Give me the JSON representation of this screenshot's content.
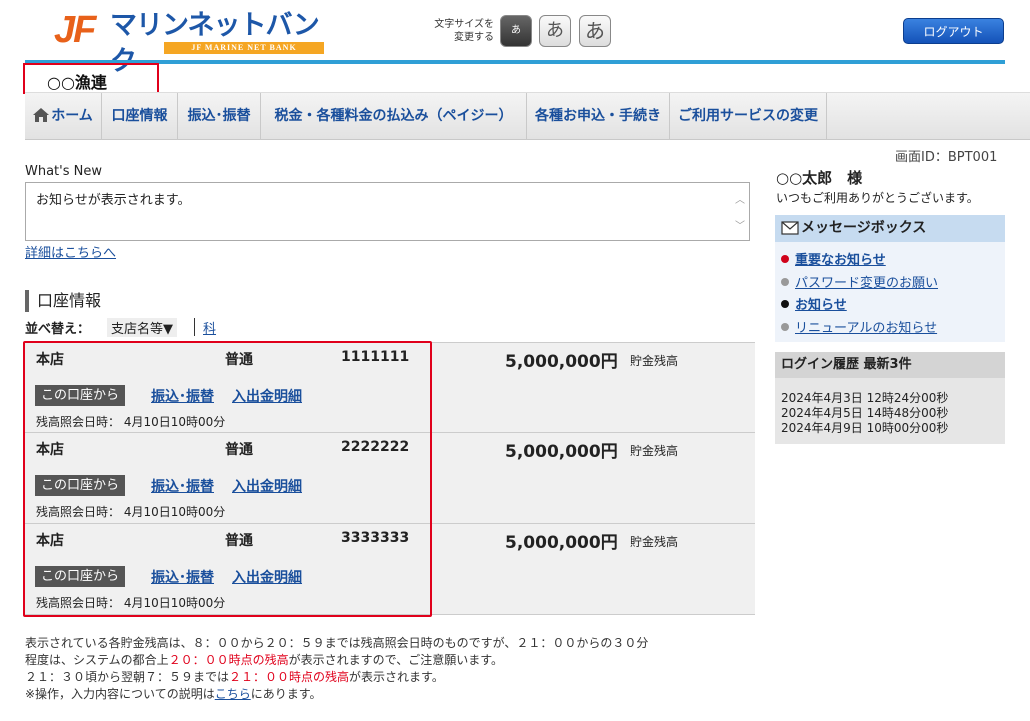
{
  "header": {
    "logo_jf": "JF",
    "logo_text": "マリンネットバンク",
    "logo_sub": "JF MARINE NET BANK",
    "font_size_label_1": "文字サイズを",
    "font_size_label_2": "変更する",
    "font_buttons": [
      "あ",
      "あ",
      "あ"
    ],
    "logout": "ログアウト",
    "org_name": "○○漁連"
  },
  "nav": {
    "items": [
      "ホーム",
      "口座情報",
      "振込･振替",
      "税金・各種料金の払込み（ペイジー）",
      "各種お申込・手続き",
      "ご利用サービスの変更"
    ]
  },
  "main": {
    "screen_id": "画面ID：BPT001",
    "whats_new_label": "What's New",
    "news_text": "お知らせが表示されます。",
    "detail_link": "詳細はこちらへ",
    "account_title": "口座情報",
    "sort_label": "並べ替え：",
    "sort_active": "支店名等▼",
    "sort_link": "科目",
    "accounts": [
      {
        "branch": "本店",
        "type": "普通",
        "number": "1111111",
        "balance": "5,000,000円",
        "balance_label": "貯金残高",
        "from_label": "この口座から",
        "transfer": "振込･振替",
        "detail": "入出金明細",
        "time": "残高照会日時： 4月10日10時00分"
      },
      {
        "branch": "本店",
        "type": "普通",
        "number": "2222222",
        "balance": "5,000,000円",
        "balance_label": "貯金残高",
        "from_label": "この口座から",
        "transfer": "振込･振替",
        "detail": "入出金明細",
        "time": "残高照会日時： 4月10日10時00分"
      },
      {
        "branch": "本店",
        "type": "普通",
        "number": "3333333",
        "balance": "5,000,000円",
        "balance_label": "貯金残高",
        "from_label": "この口座から",
        "transfer": "振込･振替",
        "detail": "入出金明細",
        "time": "残高照会日時： 4月10日10時00分"
      }
    ],
    "notes": {
      "line1": "表示されている各貯金残高は、８：００から２０：５９までは残高照会日時のものですが、２１：００からの３０分",
      "line2_a": "程度は、システムの都合上",
      "line2_red": "２０：００時点の残高",
      "line2_b": "が表示されますので、ご注意願います。",
      "line3_a": "２１：３０頃から翌朝７：５９までは",
      "line3_red": "２１：００時点の残高",
      "line3_b": "が表示されます。",
      "line4_a": "※操作，入力内容についての説明は",
      "line4_link": "こちら",
      "line4_b": "にあります。"
    }
  },
  "sidebar": {
    "user_name": "○○太郎　様",
    "greeting": "いつもご利用ありがとうございます。",
    "message_box_title": "メッセージボックス",
    "messages": [
      {
        "label": "重要なお知らせ",
        "color": "#d0021b"
      },
      {
        "label": "パスワード変更のお願い",
        "color": "#999999"
      },
      {
        "label": "お知らせ",
        "color": "#111111"
      },
      {
        "label": "リニューアルのお知らせ",
        "color": "#999999"
      }
    ],
    "login_history_title": "ログイン履歴 最新3件",
    "login_history": [
      "2024年4月3日 12時24分00秒",
      "2024年4月5日 14時48分00秒",
      "2024年4月9日 10時00分00秒"
    ]
  }
}
